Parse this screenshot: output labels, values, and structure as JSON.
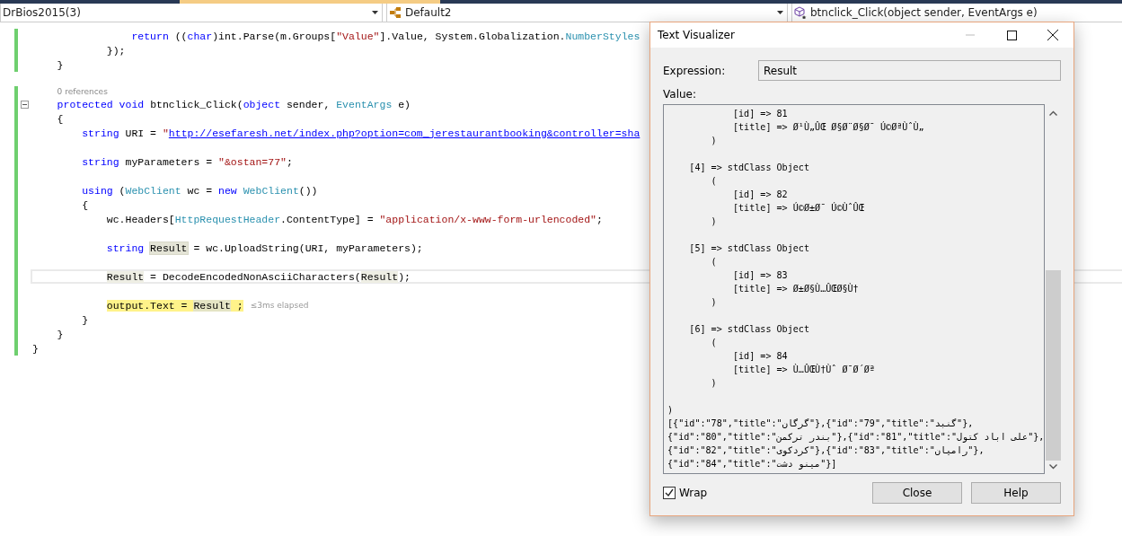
{
  "nav": {
    "project": "DrBios2015(3)",
    "class": "Default2",
    "member": "btnclick_Click(object sender, EventArgs e)"
  },
  "editor": {
    "lines": [
      {
        "kind": "block",
        "children": [
          {
            "kind": "block",
            "children": [
              {
                "kind": "block",
                "children": [
                  {
                    "kind": "block",
                    "children": [
                      {
                        "kind": "code",
                        "changed": true,
                        "current": false,
                        "collapsible": false,
                        "tokens": [
                          {
                            "text": "return ",
                            "kind": "kw"
                          },
                          {
                            "text": "((",
                            "kind": "plain"
                          },
                          {
                            "text": "char",
                            "kind": "kw"
                          },
                          {
                            "text": ")int.Parse(m.Groups[",
                            "kind": "plain"
                          },
                          {
                            "text": "\"Value\"",
                            "kind": "str"
                          },
                          {
                            "text": "].Value, System.Globalization.",
                            "kind": "plain"
                          },
                          {
                            "text": "NumberStyles",
                            "kind": "type"
                          }
                        ]
                      }
                    ]
                  },
                  {
                    "kind": "code",
                    "changed": true,
                    "current": false,
                    "collapsible": false,
                    "tokens": [
                      {
                        "text": "});",
                        "kind": "plain"
                      }
                    ]
                  }
                ]
              }
            ]
          },
          {
            "kind": "code",
            "changed": true,
            "current": false,
            "collapsible": false,
            "tokens": [
              {
                "text": "}",
                "kind": "plain"
              }
            ]
          },
          {
            "kind": "blank",
            "changed": false,
            "current": false
          },
          {
            "kind": "codelens",
            "changed": true,
            "text": "0 references"
          },
          {
            "kind": "code",
            "changed": true,
            "current": false,
            "collapsible": true,
            "tokens": [
              {
                "text": "protected ",
                "kind": "kw"
              },
              {
                "text": "void ",
                "kind": "kw"
              },
              {
                "text": "btnclick_Click(",
                "kind": "plain"
              },
              {
                "text": "object ",
                "kind": "kw"
              },
              {
                "text": "sender, ",
                "kind": "plain"
              },
              {
                "text": "EventArgs",
                "kind": "type"
              },
              {
                "text": " e)",
                "kind": "plain"
              }
            ]
          },
          {
            "kind": "code",
            "changed": true,
            "current": false,
            "collapsible": false,
            "tokens": [
              {
                "text": "{",
                "kind": "plain"
              }
            ]
          },
          {
            "kind": "block",
            "children": [
              {
                "kind": "code",
                "changed": true,
                "current": false,
                "collapsible": false,
                "tokens": [
                  {
                    "text": "string ",
                    "kind": "kw"
                  },
                  {
                    "text": "URI = ",
                    "kind": "plain"
                  },
                  {
                    "text": "\"",
                    "kind": "str"
                  },
                  {
                    "text": "http://esefaresh.net/index.php?option=com_jerestaurantbooking&controller=sha",
                    "kind": "link"
                  }
                ]
              },
              {
                "kind": "blank",
                "changed": true,
                "current": false
              },
              {
                "kind": "code",
                "changed": true,
                "current": false,
                "collapsible": false,
                "tokens": [
                  {
                    "text": "string ",
                    "kind": "kw"
                  },
                  {
                    "text": "myParameters = ",
                    "kind": "plain"
                  },
                  {
                    "text": "\"&ostan=77\"",
                    "kind": "str"
                  },
                  {
                    "text": ";",
                    "kind": "plain"
                  }
                ]
              },
              {
                "kind": "blank",
                "changed": true,
                "current": false
              },
              {
                "kind": "code",
                "changed": true,
                "current": false,
                "collapsible": false,
                "tokens": [
                  {
                    "text": "using ",
                    "kind": "kw"
                  },
                  {
                    "text": "(",
                    "kind": "plain"
                  },
                  {
                    "text": "WebClient",
                    "kind": "type"
                  },
                  {
                    "text": " wc = ",
                    "kind": "plain"
                  },
                  {
                    "text": "new ",
                    "kind": "kw"
                  },
                  {
                    "text": "WebClient",
                    "kind": "type"
                  },
                  {
                    "text": "())",
                    "kind": "plain"
                  }
                ]
              },
              {
                "kind": "code",
                "changed": true,
                "current": false,
                "collapsible": false,
                "tokens": [
                  {
                    "text": "{",
                    "kind": "plain"
                  }
                ]
              },
              {
                "kind": "block",
                "children": [
                  {
                    "kind": "code",
                    "changed": true,
                    "current": false,
                    "collapsible": false,
                    "tokens": [
                      {
                        "text": "wc.Headers[",
                        "kind": "plain"
                      },
                      {
                        "text": "HttpRequestHeader",
                        "kind": "type"
                      },
                      {
                        "text": ".ContentType] = ",
                        "kind": "plain"
                      },
                      {
                        "text": "\"application/x-www-form-urlencoded\"",
                        "kind": "str"
                      },
                      {
                        "text": ";",
                        "kind": "plain"
                      }
                    ]
                  },
                  {
                    "kind": "blank",
                    "changed": true,
                    "current": false
                  },
                  {
                    "kind": "code",
                    "changed": true,
                    "current": false,
                    "collapsible": false,
                    "tokens": [
                      {
                        "text": "string ",
                        "kind": "kw"
                      },
                      {
                        "text": "Result",
                        "kind": "decl"
                      },
                      {
                        "text": " = wc.UploadString(URI, myParameters);",
                        "kind": "plain"
                      }
                    ]
                  },
                  {
                    "kind": "blank",
                    "changed": true,
                    "current": false
                  },
                  {
                    "kind": "code",
                    "changed": true,
                    "current": true,
                    "collapsible": false,
                    "tokens": [
                      {
                        "text": "Result",
                        "kind": "ref"
                      },
                      {
                        "text": " = DecodeEncodedNonAsciiCharacters(",
                        "kind": "plain"
                      },
                      {
                        "text": "Result",
                        "kind": "ref"
                      },
                      {
                        "text": ");",
                        "kind": "plain"
                      }
                    ]
                  },
                  {
                    "kind": "blank",
                    "changed": true,
                    "current": false
                  },
                  {
                    "kind": "code",
                    "changed": true,
                    "current": false,
                    "collapsible": false,
                    "tokens": [
                      {
                        "text": "output.Text = ",
                        "kind": "exec"
                      },
                      {
                        "text": "Result",
                        "kind": "exec_ref"
                      },
                      {
                        "text": " ;",
                        "kind": "exec"
                      }
                    ],
                    "hint": "≤3ms elapsed"
                  }
                ]
              },
              {
                "kind": "code",
                "changed": true,
                "current": false,
                "collapsible": false,
                "tokens": [
                  {
                    "text": "}",
                    "kind": "plain"
                  }
                ]
              }
            ]
          },
          {
            "kind": "code",
            "changed": true,
            "current": false,
            "collapsible": false,
            "tokens": [
              {
                "text": "}",
                "kind": "plain"
              }
            ]
          }
        ]
      },
      {
        "kind": "code",
        "changed": true,
        "current": false,
        "collapsible": false,
        "tokens": [
          {
            "text": "}",
            "kind": "plain"
          }
        ]
      }
    ]
  },
  "dialog": {
    "title": "Text Visualizer",
    "expression_label": "Expression:",
    "expression": "Result",
    "value_label": "Value:",
    "value_blocks": [
      [
        "            [id] => 81",
        "            [title] => Ø¹Ù„ÛŒ Ø§Ø¨Ø§Ø¯ Ú©ØªÙˆÙ„",
        "        )"
      ],
      [
        "    [4] => stdClass Object",
        "        (",
        "            [id] => 82",
        "            [title] => Ú©Ø±Ø¯ Ú©ÙˆÛŒ",
        "        )"
      ],
      [
        "    [5] => stdClass Object",
        "        (",
        "            [id] => 83",
        "            [title] => Ø±Ø§Ù…ÛŒØ§Ù†",
        "        )"
      ],
      [
        "    [6] => stdClass Object",
        "        (",
        "            [id] => 84",
        "            [title] => Ù…ÛŒÙ†Ùˆ Ø¯Ø´Øª",
        "        )"
      ],
      [
        ")",
        "[{\"id\":\"78\",\"title\":\"گرگان\"},{\"id\":\"79\",\"title\":\"گنبد\"},",
        "{\"id\":\"80\",\"title\":\"بندر ترکمن\"},{\"id\":\"81\",\"title\":\"علی اباد کتول\"},",
        "{\"id\":\"82\",\"title\":\"کردکوی\"},{\"id\":\"83\",\"title\":\"رامیان\"},",
        "{\"id\":\"84\",\"title\":\"مینو دشت\"}]"
      ]
    ],
    "wrap": {
      "label": "Wrap",
      "checked": true
    },
    "buttons": [
      "Close",
      "Help"
    ]
  }
}
